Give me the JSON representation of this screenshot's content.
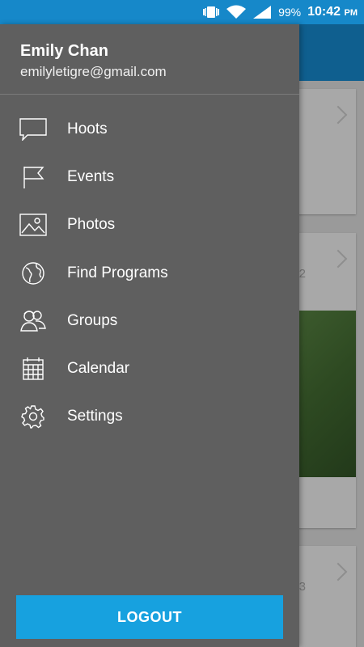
{
  "status_bar": {
    "battery_percent": "99%",
    "time": "10:42",
    "ampm": "PM"
  },
  "drawer": {
    "user_name": "Emily Chan",
    "user_email": "emilyletigre@gmail.com",
    "items": [
      {
        "label": "Hoots",
        "icon": "chat-bubble-icon"
      },
      {
        "label": "Events",
        "icon": "flag-icon"
      },
      {
        "label": "Photos",
        "icon": "image-icon"
      },
      {
        "label": "Find Programs",
        "icon": "globe-icon"
      },
      {
        "label": "Groups",
        "icon": "groups-icon"
      },
      {
        "label": "Calendar",
        "icon": "calendar-icon"
      },
      {
        "label": "Settings",
        "icon": "gear-icon"
      }
    ],
    "logout_label": "LOGOUT"
  },
  "background": {
    "partial_text_1": "2",
    "partial_text_2": "3"
  }
}
